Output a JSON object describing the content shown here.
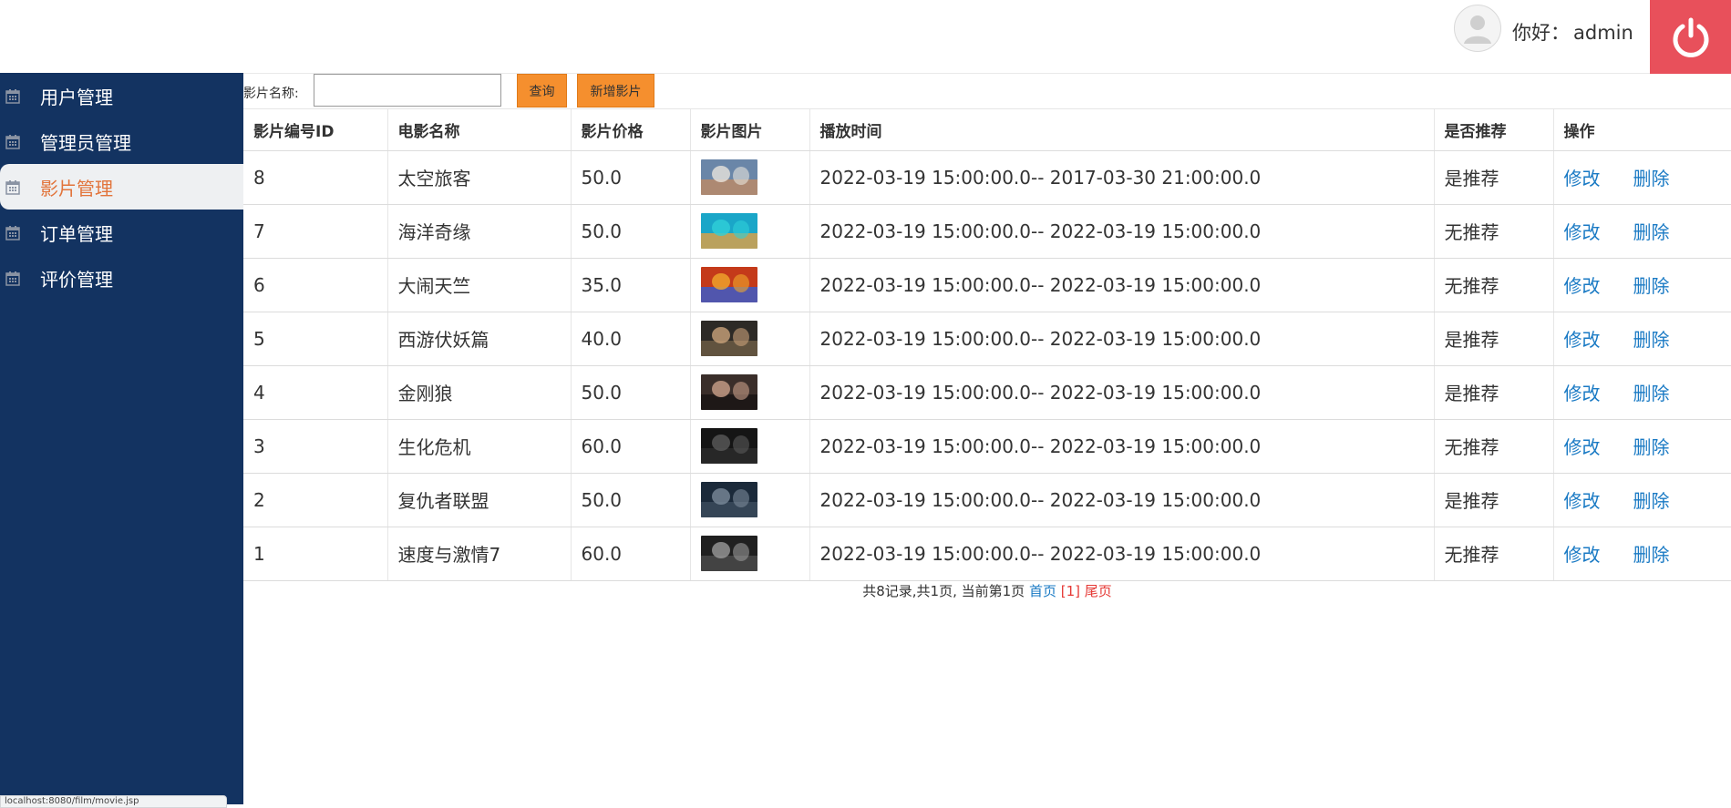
{
  "header": {
    "greeting_prefix": "你好：",
    "username": "admin"
  },
  "sidebar": {
    "items": [
      {
        "label": "用户管理",
        "active": false
      },
      {
        "label": "管理员管理",
        "active": false
      },
      {
        "label": "影片管理",
        "active": true
      },
      {
        "label": "订单管理",
        "active": false
      },
      {
        "label": "评价管理",
        "active": false
      }
    ]
  },
  "status_bar": {
    "text": "localhost:8080/film/movie.jsp"
  },
  "toolbar": {
    "search_label": "影片名称:",
    "search_value": "",
    "search_placeholder": "",
    "query_label": "查询",
    "add_label": "新增影片"
  },
  "table": {
    "headers": [
      "影片编号ID",
      "电影名称",
      "影片价格",
      "影片图片",
      "播放时间",
      "是否推荐",
      "操作"
    ],
    "edit_label": "修改",
    "delete_label": "删除",
    "rows": [
      {
        "id": "8",
        "name": "太空旅客",
        "price": "50.0",
        "time": "2022-03-19 15:00:00.0-- 2017-03-30 21:00:00.0",
        "recommend": "是推荐",
        "thumb": [
          "#6a86a8",
          "#e8e4dc",
          "#b88a68"
        ]
      },
      {
        "id": "7",
        "name": "海洋奇缘",
        "price": "50.0",
        "time": "2022-03-19 15:00:00.0-- 2022-03-19 15:00:00.0",
        "recommend": "无推荐",
        "thumb": [
          "#1aa6c8",
          "#2fd0d8",
          "#d7a04a"
        ]
      },
      {
        "id": "6",
        "name": "大闹天竺",
        "price": "35.0",
        "time": "2022-03-19 15:00:00.0-- 2022-03-19 15:00:00.0",
        "recommend": "无推荐",
        "thumb": [
          "#c43a1a",
          "#f0a82c",
          "#3d5cc8"
        ]
      },
      {
        "id": "5",
        "name": "西游伏妖篇",
        "price": "40.0",
        "time": "2022-03-19 15:00:00.0-- 2022-03-19 15:00:00.0",
        "recommend": "是推荐",
        "thumb": [
          "#2d2a26",
          "#c9a27a",
          "#6b5a44"
        ]
      },
      {
        "id": "4",
        "name": "金刚狼",
        "price": "50.0",
        "time": "2022-03-19 15:00:00.0-- 2022-03-19 15:00:00.0",
        "recommend": "是推荐",
        "thumb": [
          "#3a2e2a",
          "#caa08a",
          "#1a1414"
        ]
      },
      {
        "id": "3",
        "name": "生化危机",
        "price": "60.0",
        "time": "2022-03-19 15:00:00.0-- 2022-03-19 15:00:00.0",
        "recommend": "无推荐",
        "thumb": [
          "#151515",
          "#5a5a5a",
          "#2a2a2a"
        ]
      },
      {
        "id": "2",
        "name": "复仇者联盟",
        "price": "50.0",
        "time": "2022-03-19 15:00:00.0-- 2022-03-19 15:00:00.0",
        "recommend": "是推荐",
        "thumb": [
          "#1b2a3a",
          "#7b8a9a",
          "#3a4a5c"
        ]
      },
      {
        "id": "1",
        "name": "速度与激情7",
        "price": "60.0",
        "time": "2022-03-19 15:00:00.0-- 2022-03-19 15:00:00.0",
        "recommend": "无推荐",
        "thumb": [
          "#202020",
          "#9a9a9a",
          "#4a4a4a"
        ]
      }
    ]
  },
  "pager": {
    "summary": "共8记录,共1页, 当前第1页",
    "first_label": "首页",
    "current_label": "[1]",
    "last_label": "尾页"
  },
  "colors": {
    "sidebar_bg": "#133361",
    "active_text": "#e2743b",
    "power_button": "#e8505b",
    "button_orange": "#f58f2e",
    "link_blue": "#1a7ac4",
    "pager_red": "#e53935"
  },
  "icons": {
    "sidebar_item": "calendar-icon",
    "logout": "power-icon",
    "user": "user-avatar-icon"
  }
}
